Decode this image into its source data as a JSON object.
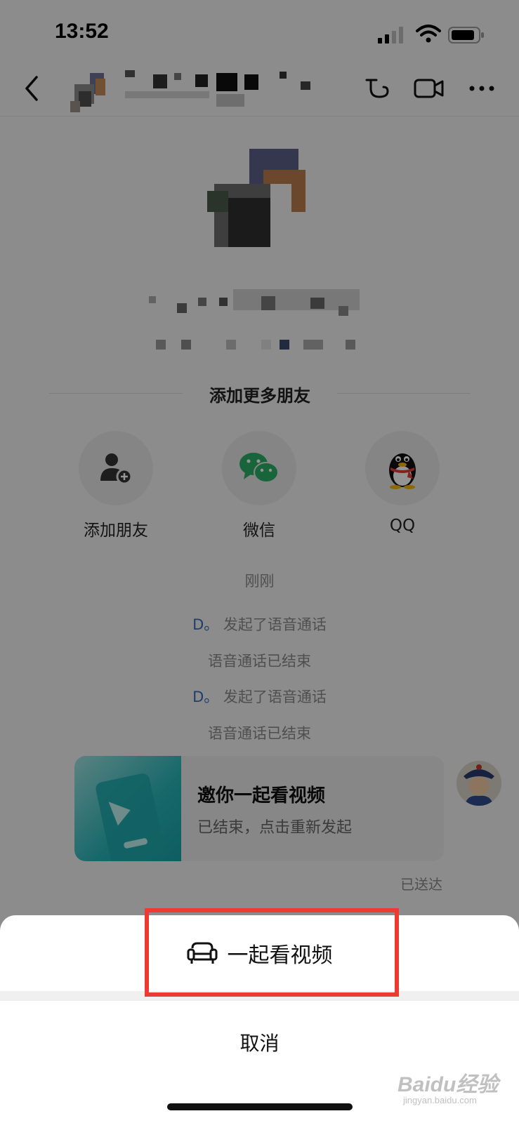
{
  "status_bar": {
    "time": "13:52"
  },
  "nav": {
    "icons": [
      "back-icon",
      "call-icon",
      "video-camera-icon",
      "more-icon"
    ]
  },
  "section": {
    "title": "添加更多朋友"
  },
  "friend_options": [
    {
      "label": "添加朋友",
      "icon": "add-user-icon"
    },
    {
      "label": "微信",
      "icon": "wechat-icon"
    },
    {
      "label": "QQ",
      "icon": "qq-penguin-icon"
    }
  ],
  "messages": {
    "time": "刚刚",
    "log": [
      {
        "who": "D。",
        "text": "发起了语音通话"
      },
      {
        "text": "语音通话已结束"
      },
      {
        "who": "D。",
        "text": "发起了语音通话"
      },
      {
        "text": "语音通话已结束"
      }
    ],
    "card": {
      "title": "邀你一起看视频",
      "subtitle": "已结束，点击重新发起"
    },
    "delivered": "已送达"
  },
  "sheet": {
    "option_label": "一起看视频",
    "option_icon": "sofa-icon",
    "cancel_label": "取消"
  },
  "watermark": {
    "main": "Baidu经验",
    "sub": "jingyan.baidu.com"
  },
  "colors": {
    "highlight": "#ee3b31",
    "link": "#3a6bb6",
    "card_accent": "#26b3b6"
  }
}
